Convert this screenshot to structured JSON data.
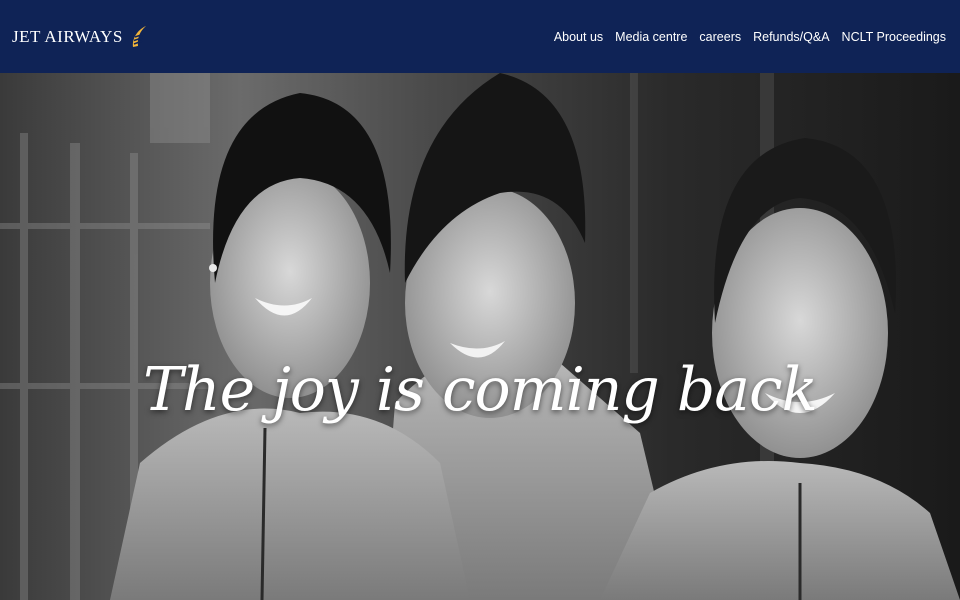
{
  "brand": {
    "name": "JET AIRWAYS",
    "logo_icon": "jet-airways-sunrise-icon",
    "logo_color": "#f2b53a"
  },
  "header": {
    "background": "#0f2356",
    "nav": [
      {
        "label": "About us"
      },
      {
        "label": "Media centre"
      },
      {
        "label": "careers"
      },
      {
        "label": "Refunds/Q&A"
      },
      {
        "label": "NCLT Proceedings"
      }
    ]
  },
  "hero": {
    "tagline": "The joy is coming back",
    "image": "black-and-white photo of three smiling flight attendants in uniform"
  }
}
